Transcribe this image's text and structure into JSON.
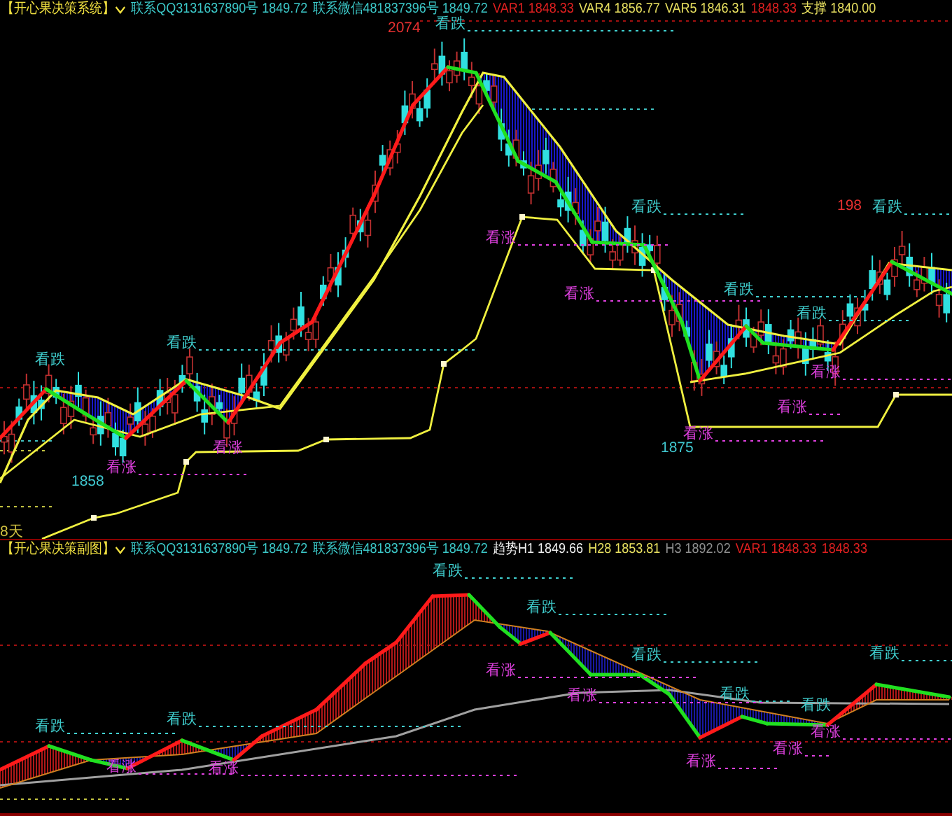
{
  "main_chart": {
    "title": "【开心果决策系统】",
    "items": [
      {
        "text": "联系QQ3131637890号 1849.72",
        "color": "#3cc8c8"
      },
      {
        "text": "联系微信481837396号 1849.72",
        "color": "#3cc8c8"
      },
      {
        "text": "VAR1 1848.33",
        "color": "#e02020"
      },
      {
        "text": "VAR4 1856.77",
        "color": "#e8e060"
      },
      {
        "text": "VAR5 1846.31",
        "color": "#e8e060"
      },
      {
        "text": "1848.33",
        "color": "#e02020"
      },
      {
        "text": "支撑 1840.00",
        "color": "#e8e060"
      }
    ],
    "annotations": [
      {
        "text": "2074",
        "kind": "high"
      },
      {
        "text": "看跌",
        "kind": "bearish"
      },
      {
        "text": "看涨",
        "kind": "bullish"
      },
      {
        "text": "看跌",
        "kind": "bearish"
      },
      {
        "text": "看涨",
        "kind": "bullish"
      },
      {
        "text": "看跌",
        "kind": "bearish"
      },
      {
        "text": "看跌",
        "kind": "bearish"
      },
      {
        "text": "看涨",
        "kind": "bullish"
      },
      {
        "text": "看涨",
        "kind": "bullish"
      },
      {
        "text": "看涨",
        "kind": "bullish"
      },
      {
        "text": "1875",
        "kind": "low"
      },
      {
        "text": "198",
        "kind": "high"
      },
      {
        "text": "看跌",
        "kind": "bearish"
      },
      {
        "text": "看跌",
        "kind": "bearish"
      },
      {
        "text": "看跌",
        "kind": "bearish"
      },
      {
        "text": "看涨",
        "kind": "bullish"
      },
      {
        "text": "1858",
        "kind": "low"
      },
      {
        "text": "看涨",
        "kind": "bullish"
      },
      {
        "text": "8天",
        "kind": "days"
      }
    ]
  },
  "sub_chart": {
    "title": "【开心果决策副图】",
    "items": [
      {
        "text": "联系QQ3131637890号 1849.72",
        "color": "#3cc8c8"
      },
      {
        "text": "联系微信481837396号 1849.72",
        "color": "#3cc8c8"
      },
      {
        "text": "趋势H1 1849.66",
        "color": "#f0f0f0"
      },
      {
        "text": "H28 1853.81",
        "color": "#e8e060"
      },
      {
        "text": "H3 1892.02",
        "color": "#909090"
      },
      {
        "text": "VAR1 1848.33",
        "color": "#e02020"
      },
      {
        "text": "1848.33",
        "color": "#e02020"
      }
    ],
    "annotations": [
      {
        "text": "看跌",
        "kind": "bearish"
      },
      {
        "text": "看跌",
        "kind": "bearish"
      },
      {
        "text": "看跌",
        "kind": "bearish"
      },
      {
        "text": "看跌",
        "kind": "bearish"
      },
      {
        "text": "看跌",
        "kind": "bearish"
      },
      {
        "text": "看跌",
        "kind": "bearish"
      },
      {
        "text": "看跌",
        "kind": "bearish"
      },
      {
        "text": "看跌",
        "kind": "bearish"
      },
      {
        "text": "看涨",
        "kind": "bullish"
      },
      {
        "text": "看涨",
        "kind": "bullish"
      },
      {
        "text": "看涨",
        "kind": "bullish"
      },
      {
        "text": "看涨",
        "kind": "bullish"
      },
      {
        "text": "看涨",
        "kind": "bullish"
      },
      {
        "text": "看涨",
        "kind": "bullish"
      },
      {
        "text": "看涨",
        "kind": "bullish"
      }
    ]
  }
}
